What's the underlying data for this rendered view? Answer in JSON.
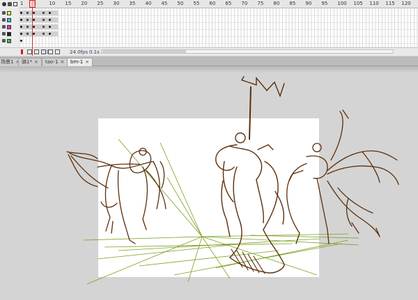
{
  "timeline": {
    "ruler_ticks": [
      "1",
      "5",
      "10",
      "15",
      "20",
      "25",
      "30",
      "35",
      "40",
      "45",
      "50",
      "55",
      "60",
      "65",
      "70",
      "75",
      "80",
      "85",
      "90",
      "95",
      "100",
      "105",
      "110",
      "115",
      "120"
    ],
    "current_frame": "3",
    "layers": [
      {
        "swatch_color": "#ffff33"
      },
      {
        "swatch_color": "#22cccc"
      },
      {
        "swatch_color": "#dd33dd"
      },
      {
        "swatch_color": "#222222"
      },
      {
        "swatch_color": "#22cc44"
      }
    ],
    "fps": "24.0",
    "fps_unit": "fps",
    "time": "0.1",
    "time_unit": "s"
  },
  "tabs": [
    {
      "label": "场景1"
    },
    {
      "label": "骑1*"
    },
    {
      "label": "tao-1"
    },
    {
      "label": "bm-1"
    }
  ],
  "colors": {
    "stroke_brown": "#5a2e0a",
    "stroke_green": "#7aa020",
    "stage": "#ffffff",
    "pasteboard": "#d4d4d4"
  }
}
